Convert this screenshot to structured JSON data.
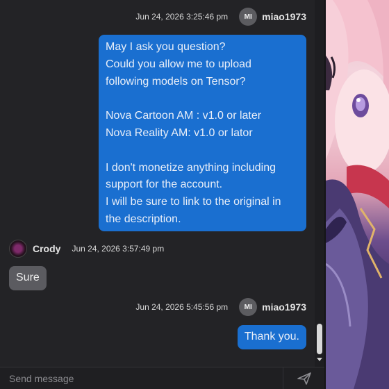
{
  "messages": [
    {
      "id": "m1",
      "side": "right",
      "time": "Jun 24, 2026 3:25:46 pm",
      "author": {
        "initials": "MI",
        "name": "miao1973"
      },
      "text": "May I ask you question?\nCould you allow me to upload\nfollowing models on Tensor?\n\nNova Cartoon AM : v1.0 or later\nNova Reality AM: v1.0 or lator\n\nI don't monetize anything including\nsupport for the account.\nI will be sure to link to the original in\nthe description."
    },
    {
      "id": "m2",
      "side": "left",
      "time": "Jun 24, 2026 3:57:49 pm",
      "author": {
        "name": "Crody"
      },
      "text": "Sure"
    },
    {
      "id": "m3",
      "side": "right",
      "time": "Jun 24, 2026 5:45:56 pm",
      "author": {
        "initials": "MI",
        "name": "miao1973"
      },
      "text": "Thank you."
    }
  ],
  "composer": {
    "placeholder": "Send message"
  },
  "icons": {
    "send": "send-icon",
    "scroll_down": "chevron-down-icon"
  },
  "colors": {
    "my_bubble": "#1a6fd0",
    "their_bubble": "#5b5b60",
    "background": "#232326"
  }
}
